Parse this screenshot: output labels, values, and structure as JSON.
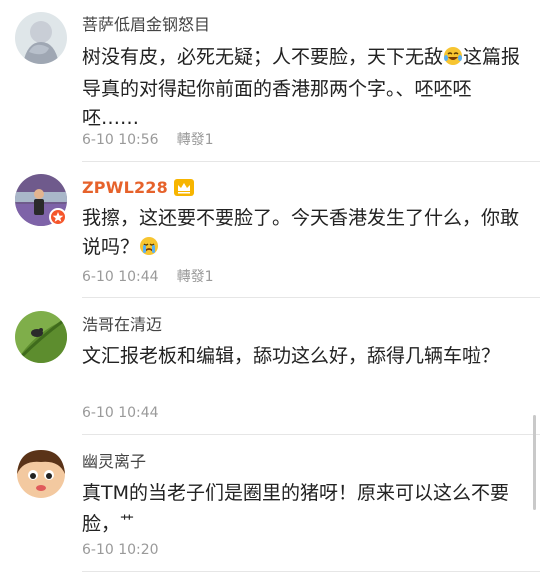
{
  "comments": [
    {
      "username": "菩萨低眉金钢怒目",
      "text": "树没有皮，必死无疑；人不要脸，天下无敌",
      "text_after_emoji": "这篇报导真的对得起你前面的香港那两个字。、呸呸呸呸……",
      "emoji": "laughing-tears-emoji",
      "time": "6-10 10:56",
      "repost": "轉發1"
    },
    {
      "username": "ZPWL228",
      "text": "我擦，这还要不要脸了。今天香港发生了什么，你敢说吗？",
      "emoji": "crying-face-emoji",
      "time": "6-10 10:44",
      "repost": "轉發1",
      "vip": true,
      "vip_badge": "crown-icon",
      "verified_badge": "star-badge-icon"
    },
    {
      "username": "浩哥在清迈",
      "text": "文汇报老板和编辑，舔功这么好，舔得几辆车啦？",
      "time": "6-10 10:44"
    },
    {
      "username": "幽灵离子",
      "text": "真TM的当老子们是圈里的猪呀！原来可以这么不要脸，",
      "text_suffix": "艹",
      "time": "6-10 10:20"
    }
  ],
  "colors": {
    "username": "#444444",
    "vip_username": "#e6622b",
    "meta": "#9a9a9a",
    "divider": "#e6e6e6"
  }
}
